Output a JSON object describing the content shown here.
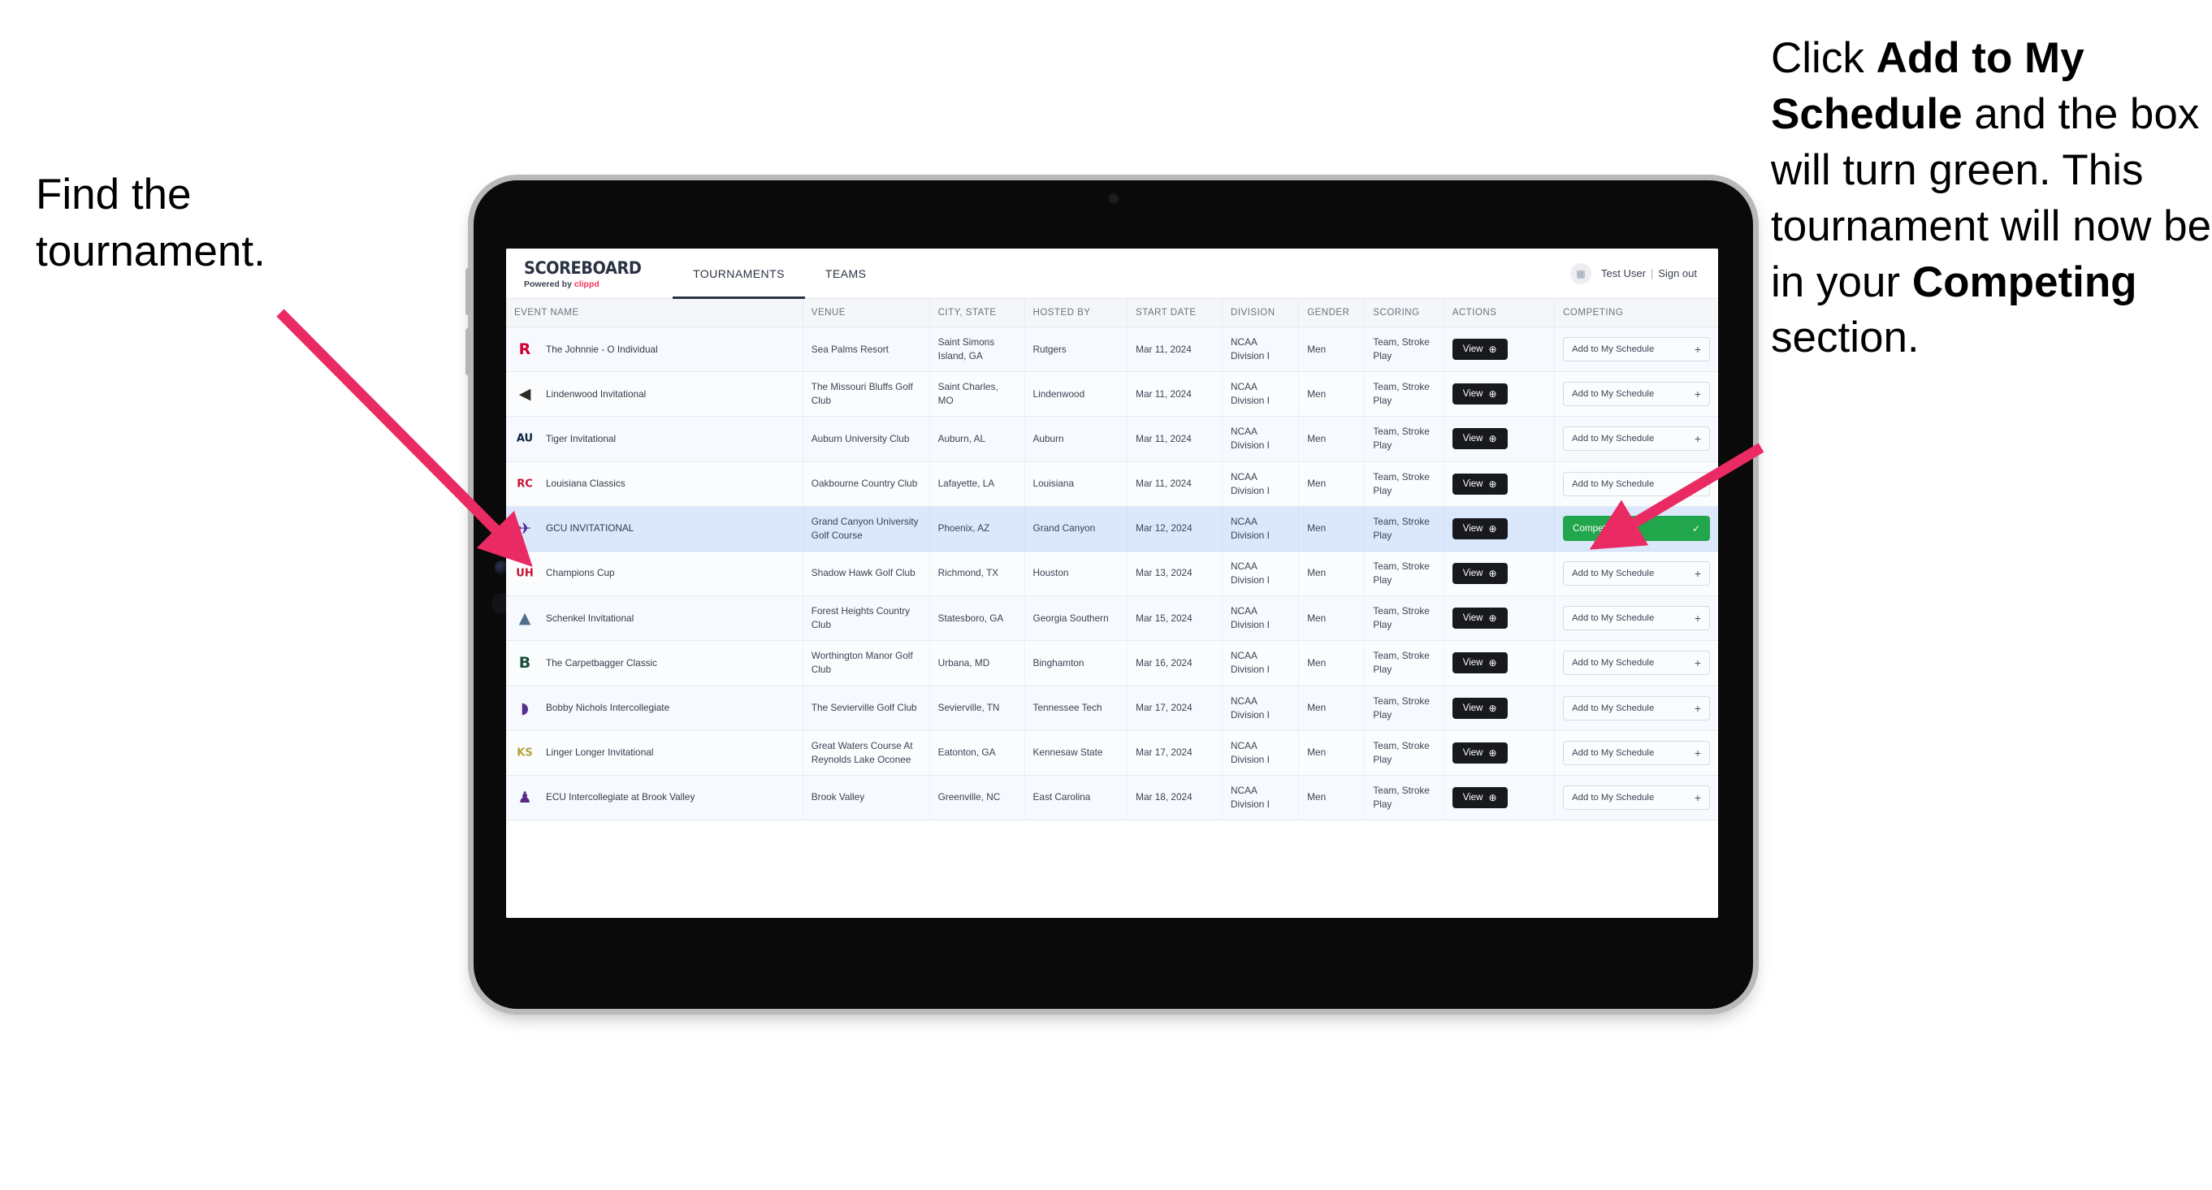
{
  "annotations": {
    "left": {
      "line1": "Find the",
      "line2": "tournament."
    },
    "right": {
      "seg1": "Click ",
      "bold1": "Add to My Schedule",
      "seg2": " and the box will turn green. This tournament will now be in your ",
      "bold2": "Competing",
      "seg3": " section."
    },
    "arrow_color": "#ea2a63"
  },
  "app": {
    "brand": {
      "name": "SCOREBOARD",
      "powered_prefix": "Powered by",
      "powered_brand": "clippd"
    },
    "tabs": [
      {
        "label": "TOURNAMENTS",
        "active": true
      },
      {
        "label": "TEAMS",
        "active": false
      }
    ],
    "user": {
      "name": "Test User",
      "separator": "|",
      "signout": "Sign out",
      "avatar_icon": "user-avatar-icon"
    }
  },
  "table": {
    "columns": [
      "EVENT NAME",
      "VENUE",
      "CITY, STATE",
      "HOSTED BY",
      "START DATE",
      "DIVISION",
      "GENDER",
      "SCORING",
      "ACTIONS",
      "COMPETING"
    ],
    "view_label": "View",
    "view_icon": "arrow-right-circle-icon",
    "add_label": "Add to My Schedule",
    "add_icon": "plus-icon",
    "competing_label": "Competing",
    "competing_icon": "check-icon",
    "competing_color": "#21a64b",
    "rows": [
      {
        "event": "The Johnnie - O Individual",
        "logo": "rutgers-logo",
        "venue": "Sea Palms Resort",
        "city": "Saint Simons Island, GA",
        "host": "Rutgers",
        "date": "Mar 11, 2024",
        "division": "NCAA Division I",
        "gender": "Men",
        "scoring": "Team, Stroke Play",
        "competing": false,
        "selected": false
      },
      {
        "event": "Lindenwood Invitational",
        "logo": "lindenwood-logo",
        "venue": "The Missouri Bluffs Golf Club",
        "city": "Saint Charles, MO",
        "host": "Lindenwood",
        "date": "Mar 11, 2024",
        "division": "NCAA Division I",
        "gender": "Men",
        "scoring": "Team, Stroke Play",
        "competing": false,
        "selected": false
      },
      {
        "event": "Tiger Invitational",
        "logo": "auburn-logo",
        "venue": "Auburn University Club",
        "city": "Auburn, AL",
        "host": "Auburn",
        "date": "Mar 11, 2024",
        "division": "NCAA Division I",
        "gender": "Men",
        "scoring": "Team, Stroke Play",
        "competing": false,
        "selected": false
      },
      {
        "event": "Louisiana Classics",
        "logo": "louisiana-ragin-cajuns-logo",
        "venue": "Oakbourne Country Club",
        "city": "Lafayette, LA",
        "host": "Louisiana",
        "date": "Mar 11, 2024",
        "division": "NCAA Division I",
        "gender": "Men",
        "scoring": "Team, Stroke Play",
        "competing": false,
        "selected": false
      },
      {
        "event": "GCU INVITATIONAL",
        "logo": "grand-canyon-lopes-logo",
        "venue": "Grand Canyon University Golf Course",
        "city": "Phoenix, AZ",
        "host": "Grand Canyon",
        "date": "Mar 12, 2024",
        "division": "NCAA Division I",
        "gender": "Men",
        "scoring": "Team, Stroke Play",
        "competing": true,
        "selected": true
      },
      {
        "event": "Champions Cup",
        "logo": "houston-cougars-logo",
        "venue": "Shadow Hawk Golf Club",
        "city": "Richmond, TX",
        "host": "Houston",
        "date": "Mar 13, 2024",
        "division": "NCAA Division I",
        "gender": "Men",
        "scoring": "Team, Stroke Play",
        "competing": false,
        "selected": false
      },
      {
        "event": "Schenkel Invitational",
        "logo": "georgia-southern-eagles-logo",
        "venue": "Forest Heights Country Club",
        "city": "Statesboro, GA",
        "host": "Georgia Southern",
        "date": "Mar 15, 2024",
        "division": "NCAA Division I",
        "gender": "Men",
        "scoring": "Team, Stroke Play",
        "competing": false,
        "selected": false
      },
      {
        "event": "The Carpetbagger Classic",
        "logo": "binghamton-bearcats-logo",
        "venue": "Worthington Manor Golf Club",
        "city": "Urbana, MD",
        "host": "Binghamton",
        "date": "Mar 16, 2024",
        "division": "NCAA Division I",
        "gender": "Men",
        "scoring": "Team, Stroke Play",
        "competing": false,
        "selected": false
      },
      {
        "event": "Bobby Nichols Intercollegiate",
        "logo": "tennessee-tech-golden-eagles-logo",
        "venue": "The Sevierville Golf Club",
        "city": "Sevierville, TN",
        "host": "Tennessee Tech",
        "date": "Mar 17, 2024",
        "division": "NCAA Division I",
        "gender": "Men",
        "scoring": "Team, Stroke Play",
        "competing": false,
        "selected": false
      },
      {
        "event": "Linger Longer Invitational",
        "logo": "kennesaw-state-owls-logo",
        "venue": "Great Waters Course At Reynolds Lake Oconee",
        "city": "Eatonton, GA",
        "host": "Kennesaw State",
        "date": "Mar 17, 2024",
        "division": "NCAA Division I",
        "gender": "Men",
        "scoring": "Team, Stroke Play",
        "competing": false,
        "selected": false
      },
      {
        "event": "ECU Intercollegiate at Brook Valley",
        "logo": "east-carolina-pirates-logo",
        "venue": "Brook Valley",
        "city": "Greenville, NC",
        "host": "East Carolina",
        "date": "Mar 18, 2024",
        "division": "NCAA Division I",
        "gender": "Men",
        "scoring": "Team, Stroke Play",
        "competing": false,
        "selected": false
      }
    ]
  }
}
